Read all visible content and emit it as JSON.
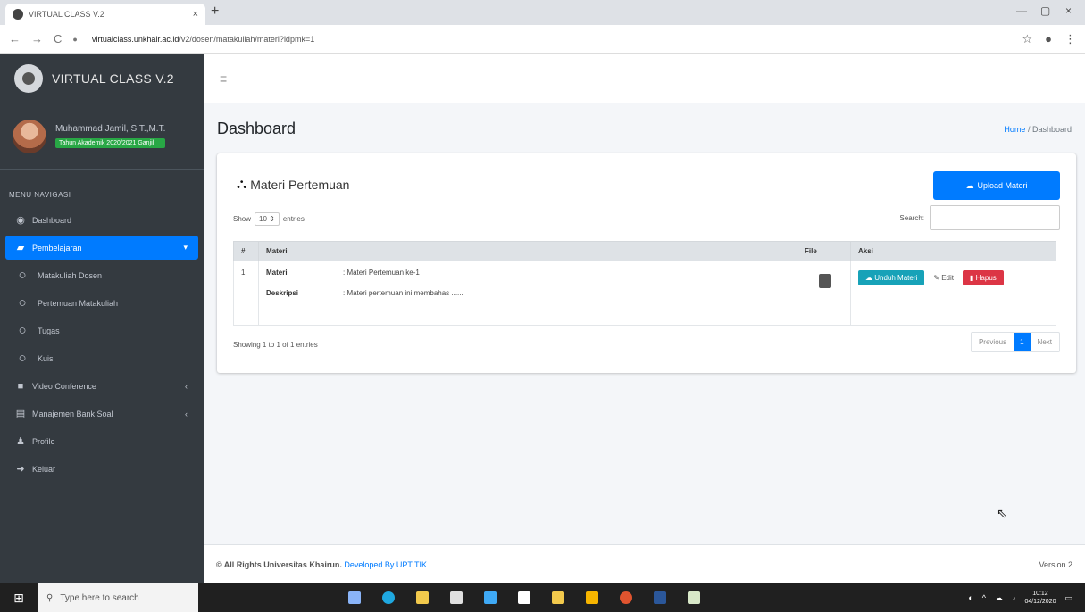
{
  "browser": {
    "tab_title": "VIRTUAL CLASS V.2",
    "tab_close": "×",
    "new_tab": "+",
    "nav_back": "←",
    "nav_forward": "→",
    "nav_reload": "C",
    "url_host": "virtualclass.unkhair.ac.id",
    "url_path": "/v2/dosen/matakuliah/materi?idpmk=1",
    "minimize": "—",
    "maximize": "▢",
    "close": "×"
  },
  "sidebar": {
    "brand": "VIRTUAL CLASS V.2",
    "user_name": "Muhammad Jamil, S.T.,M.T.",
    "user_badge": "Tahun Akademik 2020/2021 Ganjil",
    "menu_header": "MENU NAVIGASI",
    "items": [
      {
        "label": "Dashboard",
        "icon": "dashboard-icon"
      },
      {
        "label": "Pembelajaran",
        "icon": "book-icon",
        "arrow": "▾"
      },
      {
        "label": "Matakuliah Dosen",
        "icon": "circle-icon"
      },
      {
        "label": "Pertemuan Matakuliah",
        "icon": "circle-icon"
      },
      {
        "label": "Tugas",
        "icon": "circle-icon"
      },
      {
        "label": "Kuis",
        "icon": "circle-icon"
      },
      {
        "label": "Video Conference",
        "icon": "video-icon",
        "arrow": "‹"
      },
      {
        "label": "Manajemen Bank Soal",
        "icon": "database-icon",
        "arrow": "‹"
      },
      {
        "label": "Profile",
        "icon": "user-icon"
      },
      {
        "label": "Keluar",
        "icon": "sign-out-icon"
      }
    ]
  },
  "header": {
    "menu_toggle": "≡",
    "page_title": "Dashboard",
    "breadcrumb_home": "Home",
    "breadcrumb_sep": "/",
    "breadcrumb_current": "Dashboard"
  },
  "card": {
    "title": "Materi Pertemuan",
    "upload_label": "Upload Materi",
    "show_label": "Show",
    "entries_value": "10",
    "entries_label": "entries",
    "search_label": "Search:",
    "table": {
      "headers": [
        "#",
        "Materi",
        "File",
        "Aksi"
      ],
      "rows": [
        {
          "no": "1",
          "materi_key": "Materi",
          "materi_val": ": Materi Pertemuan ke-1",
          "desc_key": "Deskripsi",
          "desc_val": ": Materi pertemuan ini membahas ......"
        }
      ]
    },
    "btn_unduh": "Unduh Materi",
    "btn_edit": "Edit",
    "btn_hapus": "Hapus",
    "info": "Showing 1 to 1 of 1 entries",
    "pager": {
      "prev": "Previous",
      "current": "1",
      "next": "Next"
    }
  },
  "footer": {
    "rights": "© All Rights Universitas Khairun.",
    "developed": "Developed By UPT TIK",
    "version": "Version 2"
  },
  "taskbar": {
    "search_placeholder": "Type here to search",
    "time": "10:12",
    "date": "04/12/2020"
  },
  "colors": {
    "sidebar_bg": "#343a40",
    "primary": "#007bff",
    "info": "#17a2b8",
    "danger": "#dc3545",
    "success": "#28a745"
  }
}
